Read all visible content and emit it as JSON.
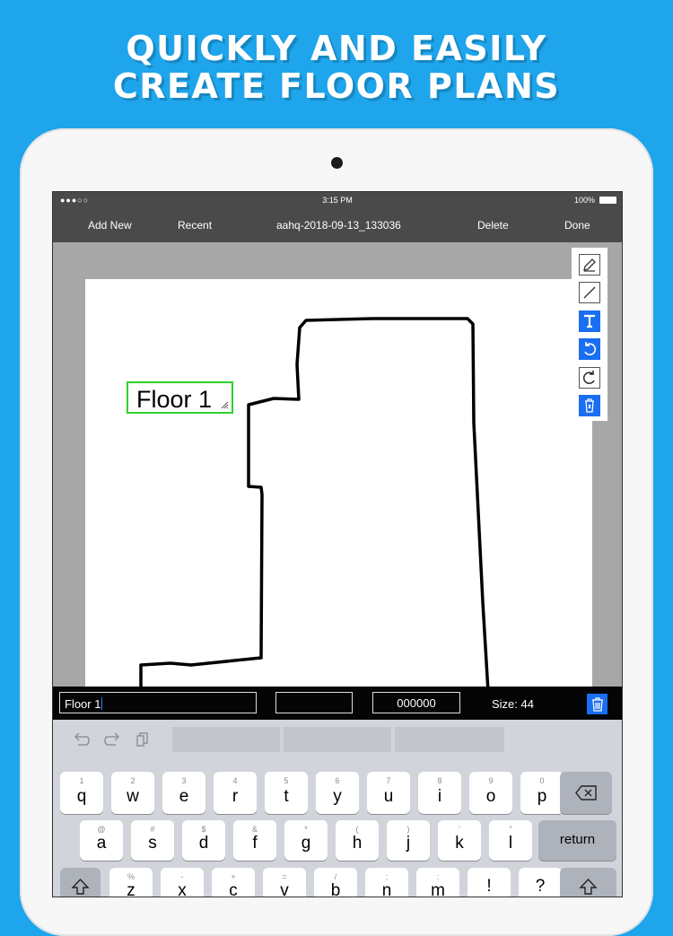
{
  "headline": {
    "line1": "QUICKLY AND EASILY",
    "line2": "CREATE FLOOR PLANS"
  },
  "status_bar": {
    "signal": "●●●○○",
    "time": "3:15 PM",
    "battery": "100%"
  },
  "nav": {
    "add_new": "Add New",
    "recent": "Recent",
    "title": "aahq-2018-09-13_133036",
    "delete": "Delete",
    "done": "Done"
  },
  "canvas": {
    "label_text": "Floor 1"
  },
  "tools": [
    "pencil-icon",
    "line-icon",
    "text-tool-icon",
    "undo-icon",
    "redo-icon",
    "clear-icon"
  ],
  "bottom_bar": {
    "text_value": "Floor 1",
    "color_hex": "000000",
    "size_label": "Size: 44"
  },
  "keyboard": {
    "row1": [
      {
        "hint": "1",
        "key": "q"
      },
      {
        "hint": "2",
        "key": "w"
      },
      {
        "hint": "3",
        "key": "e"
      },
      {
        "hint": "4",
        "key": "r"
      },
      {
        "hint": "5",
        "key": "t"
      },
      {
        "hint": "6",
        "key": "y"
      },
      {
        "hint": "7",
        "key": "u"
      },
      {
        "hint": "8",
        "key": "i"
      },
      {
        "hint": "9",
        "key": "o"
      },
      {
        "hint": "0",
        "key": "p"
      }
    ],
    "row2": [
      {
        "hint": "@",
        "key": "a"
      },
      {
        "hint": "#",
        "key": "s"
      },
      {
        "hint": "$",
        "key": "d"
      },
      {
        "hint": "&",
        "key": "f"
      },
      {
        "hint": "*",
        "key": "g"
      },
      {
        "hint": "(",
        "key": "h"
      },
      {
        "hint": ")",
        "key": "j"
      },
      {
        "hint": "'",
        "key": "k"
      },
      {
        "hint": "\"",
        "key": "l"
      }
    ],
    "row3": [
      {
        "hint": "%",
        "key": "z"
      },
      {
        "hint": "-",
        "key": "x"
      },
      {
        "hint": "+",
        "key": "c"
      },
      {
        "hint": "=",
        "key": "v"
      },
      {
        "hint": "/",
        "key": "b"
      },
      {
        "hint": ";",
        "key": "n"
      },
      {
        "hint": ":",
        "key": "m"
      },
      {
        "hint": "",
        "key": "!\n,"
      },
      {
        "hint": "",
        "key": "?\n."
      }
    ],
    "return_label": "return"
  },
  "colors": {
    "background": "#1ea5ec",
    "accent_blue": "#1a6ef0",
    "selection_green": "#2bd12b",
    "bar_dark": "#4a4a4a"
  }
}
